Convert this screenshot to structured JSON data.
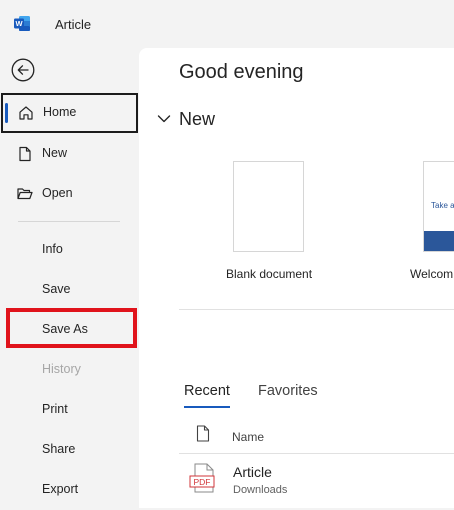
{
  "titlebar": {
    "app_icon": "word-icon",
    "document_title": "Article"
  },
  "sidebar": {
    "back_icon": "back-arrow-icon",
    "items": [
      {
        "label": "Home",
        "icon": "home-icon",
        "state": "selected"
      },
      {
        "label": "New",
        "icon": "new-document-icon"
      },
      {
        "label": "Open",
        "icon": "folder-open-icon"
      },
      {
        "label": "Info"
      },
      {
        "label": "Save"
      },
      {
        "label": "Save As",
        "state": "highlighted"
      },
      {
        "label": "History",
        "state": "disabled"
      },
      {
        "label": "Print"
      },
      {
        "label": "Share"
      },
      {
        "label": "Export"
      }
    ]
  },
  "main": {
    "greeting": "Good evening",
    "new_section": {
      "title": "New",
      "templates": [
        {
          "label": "Blank document"
        },
        {
          "label": "Welcom",
          "thumb_text": "Take a"
        }
      ]
    },
    "tabs": [
      {
        "label": "Recent",
        "active": true
      },
      {
        "label": "Favorites",
        "active": false
      }
    ],
    "list": {
      "name_header": "Name",
      "files": [
        {
          "name": "Article",
          "location": "Downloads",
          "type_badge": "PDF"
        }
      ]
    }
  },
  "colors": {
    "accent": "#185abd",
    "highlight_box": "#e0131b",
    "pdf_red": "#d13438"
  }
}
